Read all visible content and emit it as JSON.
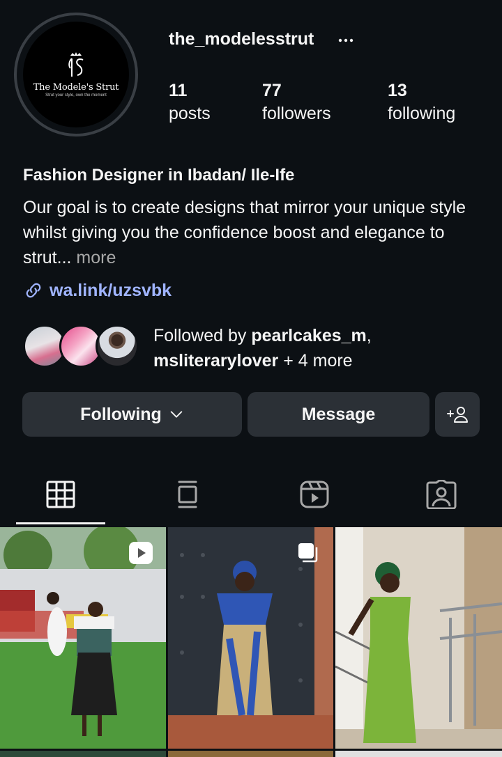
{
  "profile": {
    "username": "the_modelesstrut",
    "avatar_brand": "The Modele's Strut",
    "avatar_tagline": "Strut your style, own the moment"
  },
  "stats": {
    "posts_count": "11",
    "posts_label": "posts",
    "followers_count": "77",
    "followers_label": "followers",
    "following_count": "13",
    "following_label": "following"
  },
  "bio": {
    "name": "Fashion Designer in Ibadan/ Ile-Ife",
    "text": "Our goal is to create designs that mirror your unique style whilst giving you the confidence boost and elegance to strut...",
    "more": "more",
    "link": "wa.link/uzsvbk"
  },
  "followed_by": {
    "prefix": "Followed by ",
    "user1": "pearlcakes_m",
    "sep": ",",
    "user2": "msliterarylover",
    "suffix": " + 4 more"
  },
  "actions": {
    "following": "Following",
    "message": "Message"
  },
  "tabs": [
    "grid-icon",
    "feed-icon",
    "reels-icon",
    "tagged-icon"
  ],
  "colors": {
    "background": "#0c1014",
    "button": "#2b3036",
    "link": "#a0b4ff",
    "muted": "#a8a8a8"
  }
}
